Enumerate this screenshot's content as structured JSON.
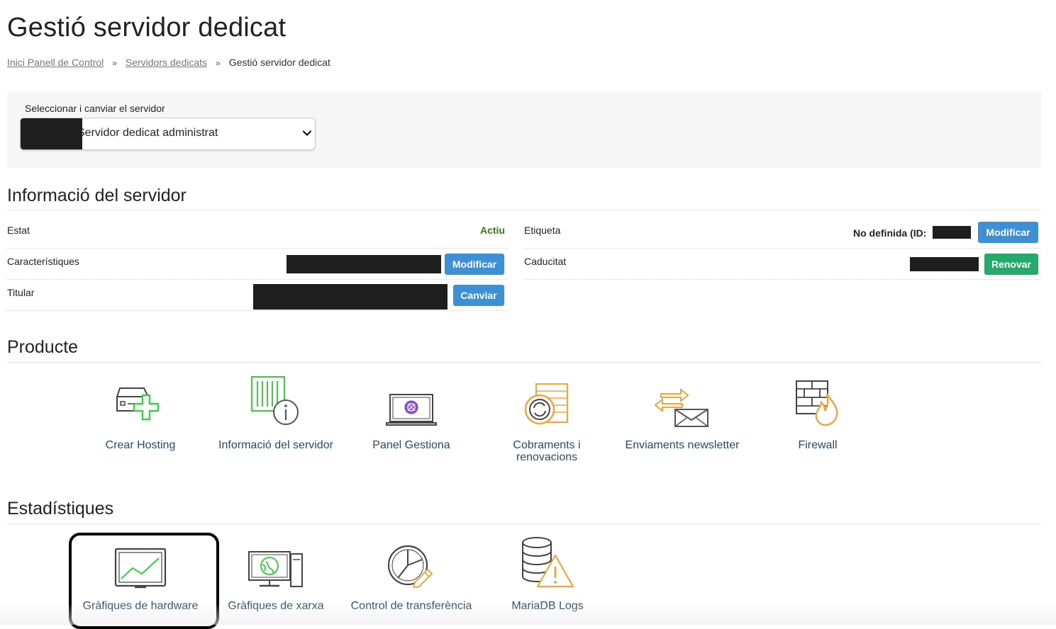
{
  "page": {
    "title": "Gestió servidor dedicat"
  },
  "breadcrumb": {
    "items": [
      "Inici Panell de Control",
      "Servidors dedicats",
      "Gestió servidor dedicat"
    ],
    "separator": "»"
  },
  "server_selector": {
    "label": "Seleccionar i canviar el servidor",
    "selected_value": "Servidor dedicat administrat"
  },
  "server_info": {
    "title": "Informació del servidor",
    "rows": {
      "estat": {
        "label": "Estat",
        "value": "Actiu"
      },
      "caracteristiques": {
        "label": "Característiques",
        "button": "Modificar"
      },
      "titular": {
        "label": "Titular",
        "button": "Canviar"
      },
      "etiqueta": {
        "label": "Etiqueta",
        "value": "No definida (ID:",
        "button": "Modificar"
      },
      "caducitat": {
        "label": "Caducitat",
        "button": "Renovar"
      }
    }
  },
  "product": {
    "title": "Producte",
    "items": [
      {
        "label": "Crear Hosting",
        "icon": "server-plus-icon"
      },
      {
        "label": "Informació del servidor",
        "icon": "server-info-icon"
      },
      {
        "label": "Panel Gestiona",
        "icon": "laptop-panel-icon"
      },
      {
        "label": "Cobraments i renovacions",
        "icon": "billing-renewal-icon"
      },
      {
        "label": "Enviaments newsletter",
        "icon": "newsletter-envelope-icon"
      },
      {
        "label": "Firewall",
        "icon": "firewall-flame-icon"
      }
    ]
  },
  "stats": {
    "title": "Estadístiques",
    "items": [
      {
        "label": "Gràfiques de hardware",
        "icon": "hardware-chart-icon"
      },
      {
        "label": "Gràfiques de xarxa",
        "icon": "network-monitor-icon"
      },
      {
        "label": "Control de transferència",
        "icon": "transfer-pie-icon"
      },
      {
        "label": "MariaDB Logs",
        "icon": "database-warning-icon"
      }
    ]
  },
  "colors": {
    "accent_blue": "#3d8fd6",
    "accent_green": "#26a96c",
    "status_active": "#2f7d0c",
    "icon_green": "#3fcf45",
    "icon_orange": "#f5a33a",
    "link_label": "#2a4a6a"
  }
}
